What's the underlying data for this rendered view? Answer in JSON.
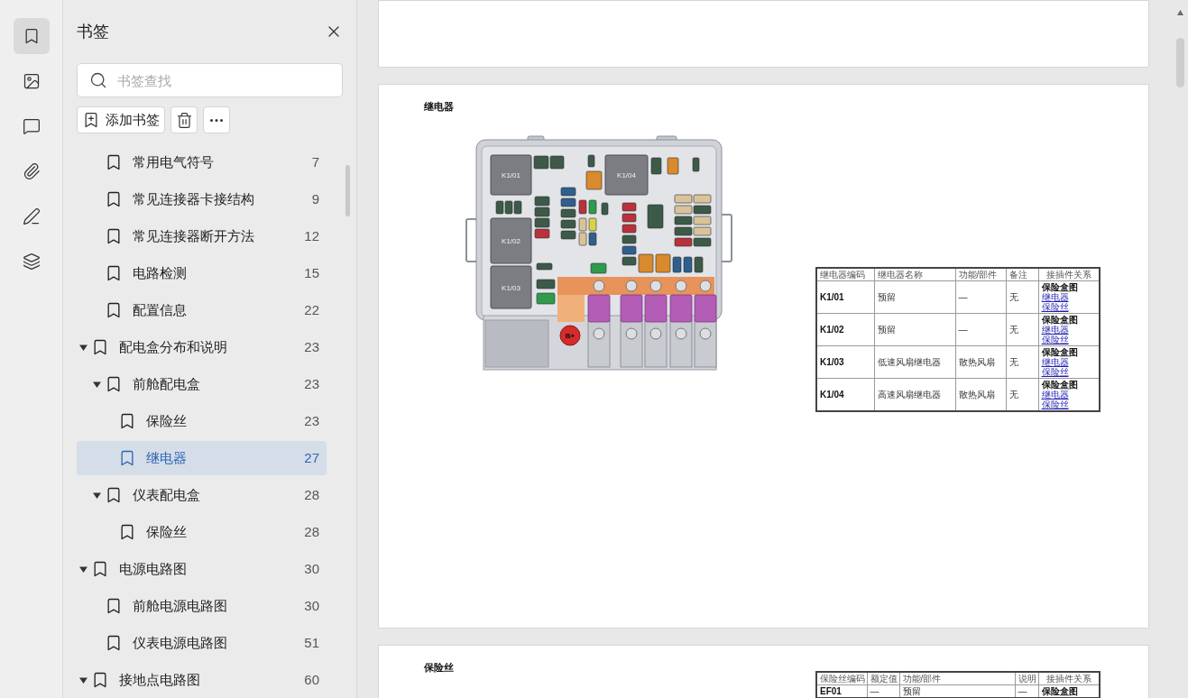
{
  "sidebar_tabs": [
    {
      "selected": true
    },
    {
      "selected": false
    },
    {
      "selected": false
    },
    {
      "selected": false
    },
    {
      "selected": false
    },
    {
      "selected": false
    }
  ],
  "bookmarks_panel": {
    "title": "书签",
    "search": {
      "placeholder": "书签查找"
    },
    "add_button": "添加书签",
    "tree": [
      {
        "children": [
          {
            "label": "常用电气符号",
            "page": "7",
            "selected": false
          },
          {
            "label": "常见连接器卡接结构",
            "page": "9",
            "selected": false
          },
          {
            "label": "常见连接器断开方法",
            "page": "12",
            "selected": false
          },
          {
            "label": "电路检测",
            "page": "15",
            "selected": false
          },
          {
            "label": "配置信息",
            "page": "22",
            "selected": false
          }
        ]
      },
      {
        "label": "配电盒分布和说明",
        "page": "23",
        "selected": false,
        "expanded": true,
        "children": [
          {
            "label": "前舱配电盒",
            "page": "23",
            "selected": false,
            "expanded": true,
            "children": [
              {
                "label": "保险丝",
                "page": "23",
                "selected": false
              },
              {
                "label": "继电器",
                "page": "27",
                "selected": true
              }
            ]
          },
          {
            "label": "仪表配电盒",
            "page": "28",
            "selected": false,
            "expanded": true,
            "children": [
              {
                "label": "保险丝",
                "page": "28",
                "selected": false
              }
            ]
          }
        ]
      },
      {
        "label": "电源电路图",
        "page": "30",
        "selected": false,
        "expanded": true,
        "children": [
          {
            "label": "前舱电源电路图",
            "page": "30",
            "selected": false
          },
          {
            "label": "仪表电源电路图",
            "page": "51",
            "selected": false
          }
        ]
      },
      {
        "label": "接地点电路图",
        "page": "60",
        "selected": false,
        "expanded": true
      }
    ]
  },
  "document": {
    "pages": [
      {
        "kind": "blank"
      },
      {
        "kind": "content",
        "title": "继电器",
        "figure": {
          "relays": [
            "K1/01",
            "K1/02",
            "K1/03",
            "K1/04"
          ],
          "terminal": "B+"
        },
        "table": {
          "kind": "relay",
          "columns": [
            "继电器编码",
            "继电器名称",
            "功能/部件",
            "备注",
            "接插件关系"
          ],
          "rows": [
            {
              "cells": [
                "K1/01",
                "预留",
                "—",
                "无"
              ],
              "links": [
                {
                  "label": "保险盒图",
                  "kind": "heading"
                },
                {
                  "label": "继电器",
                  "kind": "link"
                },
                {
                  "label": "保险丝",
                  "kind": "link"
                }
              ]
            },
            {
              "cells": [
                "K1/02",
                "预留",
                "—",
                "无"
              ],
              "links": [
                {
                  "label": "保险盒图",
                  "kind": "heading"
                },
                {
                  "label": "继电器",
                  "kind": "link"
                },
                {
                  "label": "保险丝",
                  "kind": "link"
                }
              ]
            },
            {
              "cells": [
                "K1/03",
                "低速风扇继电器",
                "散热风扇",
                "无"
              ],
              "links": [
                {
                  "label": "保险盒图",
                  "kind": "heading"
                },
                {
                  "label": "继电器",
                  "kind": "link"
                },
                {
                  "label": "保险丝",
                  "kind": "link"
                }
              ]
            },
            {
              "cells": [
                "K1/04",
                "高速风扇继电器",
                "散热风扇",
                "无"
              ],
              "links": [
                {
                  "label": "保险盒图",
                  "kind": "heading"
                },
                {
                  "label": "继电器",
                  "kind": "link"
                },
                {
                  "label": "保险丝",
                  "kind": "link"
                }
              ]
            }
          ]
        }
      },
      {
        "kind": "content",
        "title": "保险丝",
        "table": {
          "kind": "fuse",
          "columns": [
            "保险丝编码",
            "额定值",
            "功能/部件",
            "说明",
            "接插件关系"
          ],
          "rows": [
            {
              "cells": [
                "EF01",
                "—",
                "预留",
                "—"
              ],
              "links": [
                {
                  "label": "保险盒图",
                  "kind": "heading"
                }
              ]
            }
          ]
        }
      }
    ]
  }
}
